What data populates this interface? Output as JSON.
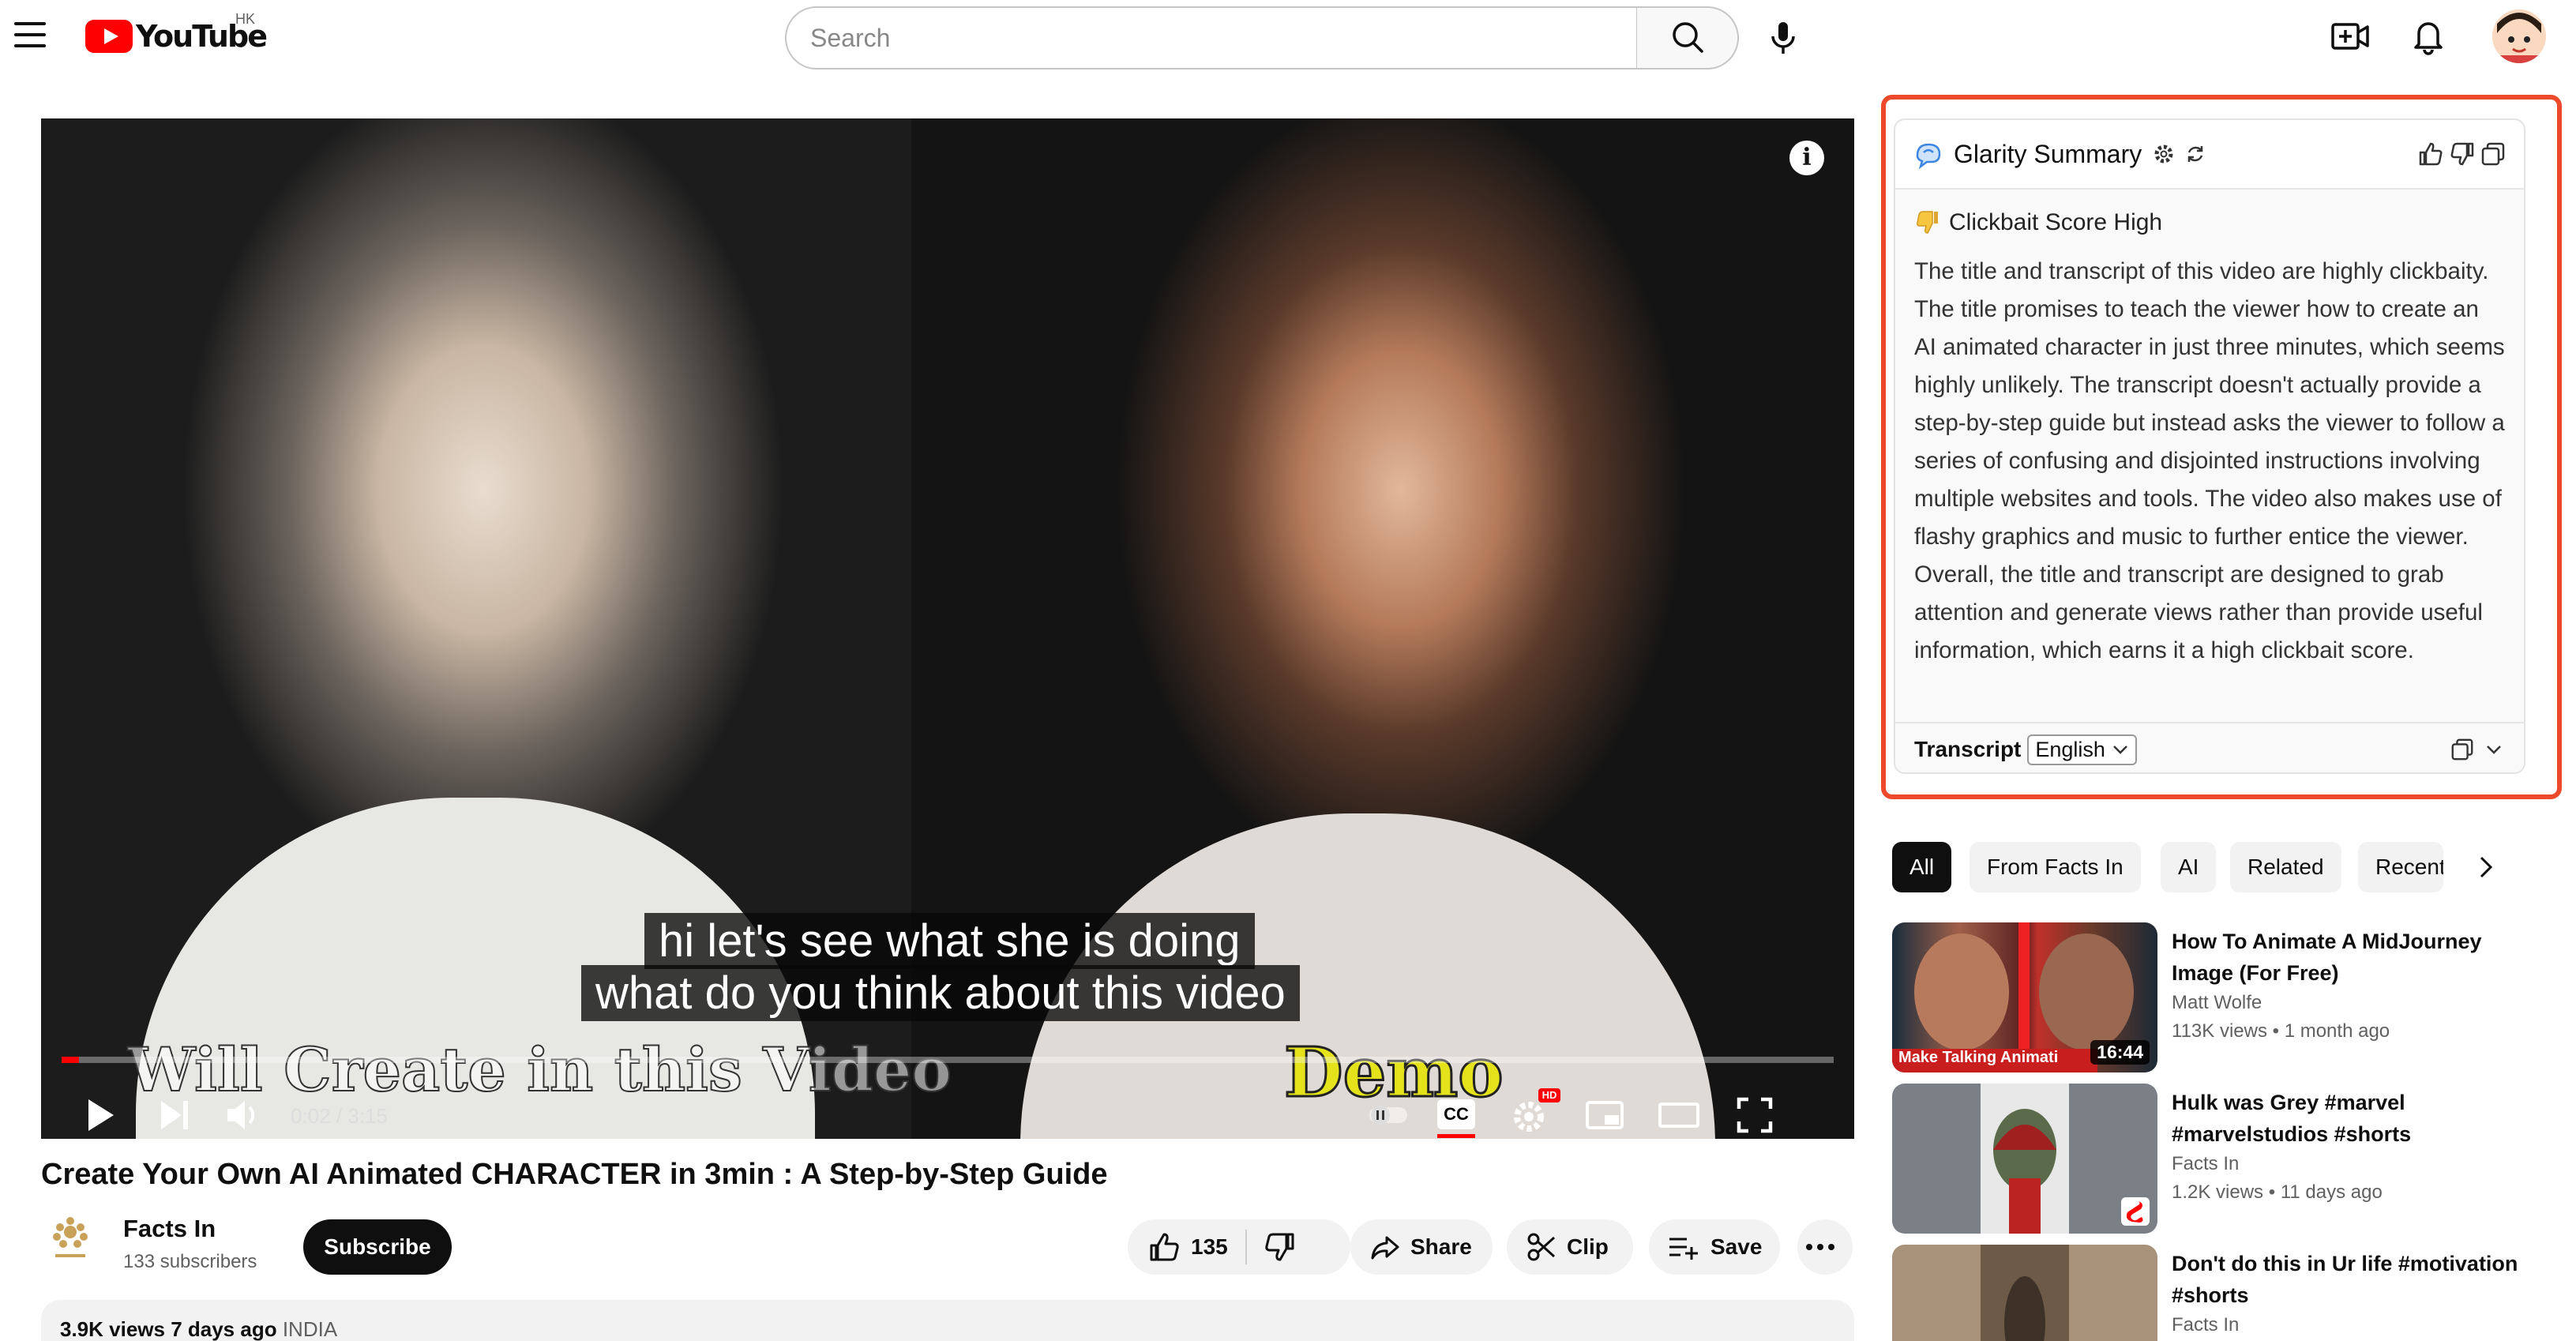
{
  "header": {
    "logo_text": "YouTube",
    "region": "HK",
    "search_placeholder": "Search"
  },
  "player": {
    "captions": [
      "hi let's see what she is doing",
      "what do you think about this video"
    ],
    "overlay_text": "Will Create in this Video",
    "overlay_badge": "Demo",
    "time": "0:02 / 3:15",
    "progress_fraction": 0.01,
    "cc_label": "CC",
    "hd_badge": "HD"
  },
  "video": {
    "title": "Create Your Own AI Animated CHARACTER in 3min : A Step-by-Step Guide",
    "channel_name": "Facts In",
    "channel_subs": "133 subscribers",
    "subscribe_label": "Subscribe",
    "likes": "135",
    "share_label": "Share",
    "clip_label": "Clip",
    "save_label": "Save",
    "views_date": "3.9K views  7 days ago",
    "location": "INDIA"
  },
  "glarity": {
    "title": "Glarity Summary",
    "score_label": "Clickbait Score High",
    "summary": "The title and transcript of this video are highly clickbaity. The title promises to teach the viewer how to create an AI animated character in just three minutes, which seems highly unlikely. The transcript doesn't actually provide a step-by-step guide but instead asks the viewer to follow a series of confusing and disjointed instructions involving multiple websites and tools. The video also makes use of flashy graphics and music to further entice the viewer. Overall, the title and transcript are designed to grab attention and generate views rather than provide useful information, which earns it a high clickbait score.",
    "transcript_label": "Transcript",
    "language": "English",
    "accent_color": "#ec4a2a"
  },
  "chips": [
    "All",
    "From Facts In",
    "AI",
    "Related",
    "Recent"
  ],
  "related": [
    {
      "title": "How To Animate A MidJourney Image (For Free)",
      "channel": "Matt Wolfe",
      "views": "113K views",
      "age": "1 month ago",
      "duration": "16:44",
      "thumb_text": "Make Talking Animati"
    },
    {
      "title": "Hulk was Grey #marvel #marvelstudios #shorts",
      "channel": "Facts In",
      "views": "1.2K views",
      "age": "11 days ago"
    },
    {
      "title": "Don't do this in Ur life #motivation #shorts",
      "channel": "Facts In"
    }
  ]
}
